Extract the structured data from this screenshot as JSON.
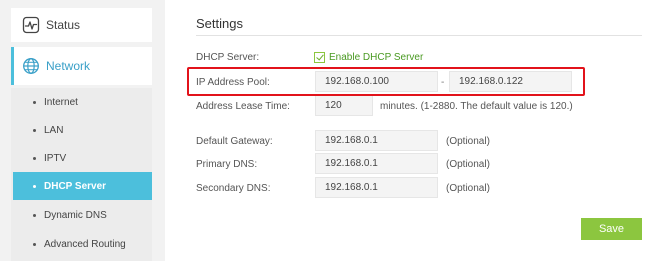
{
  "sidebar": {
    "status": {
      "label": "Status",
      "icon": "status-pulse-icon"
    },
    "network": {
      "label": "Network",
      "icon": "globe-icon"
    },
    "items": [
      {
        "label": "Internet"
      },
      {
        "label": "LAN"
      },
      {
        "label": "IPTV"
      },
      {
        "label": "DHCP Server",
        "active": true
      },
      {
        "label": "Dynamic DNS"
      },
      {
        "label": "Advanced Routing"
      }
    ]
  },
  "main": {
    "title": "Settings",
    "dhcp_server": {
      "label": "DHCP Server:",
      "checkbox_label": "Enable DHCP Server",
      "checked": true
    },
    "ip_pool": {
      "label": "IP Address Pool:",
      "start": "192.168.0.100",
      "separator": "-",
      "end": "192.168.0.122"
    },
    "lease_time": {
      "label": "Address Lease Time:",
      "value": "120",
      "hint": "minutes. (1-2880. The default value is 120.)"
    },
    "default_gateway": {
      "label": "Default Gateway:",
      "value": "192.168.0.1",
      "hint": "(Optional)"
    },
    "primary_dns": {
      "label": "Primary DNS:",
      "value": "192.168.0.1",
      "hint": "(Optional)"
    },
    "secondary_dns": {
      "label": "Secondary DNS:",
      "value": "192.168.0.1",
      "hint": "(Optional)"
    },
    "save_label": "Save"
  },
  "colors": {
    "accent": "#4cbfdc",
    "save_button": "#8cc63f",
    "highlight_border": "#e2131b"
  }
}
